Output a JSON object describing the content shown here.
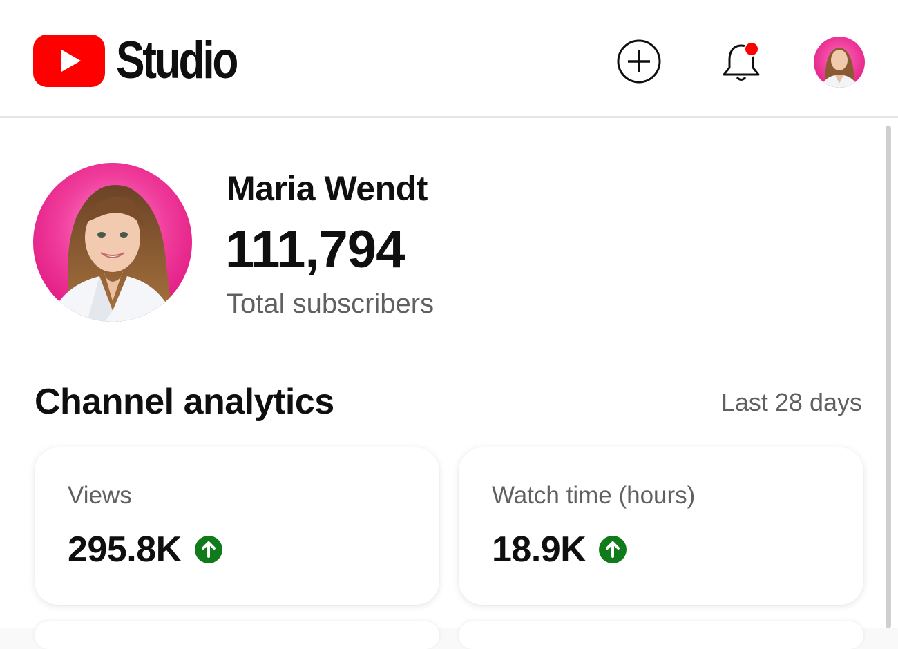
{
  "app": {
    "logo_icon": "youtube-play-logo",
    "logo_text": "Studio",
    "brand_color": "#ff0000"
  },
  "header": {
    "create_icon": "plus-circle-icon",
    "notifications_icon": "bell-icon",
    "notification_badge_color": "#ff0000",
    "account_icon": "account-avatar"
  },
  "channel": {
    "name": "Maria Wendt",
    "subscriber_count": "111,794",
    "subscriber_label": "Total subscribers",
    "avatar_background": "#e8228a"
  },
  "analytics": {
    "title": "Channel analytics",
    "period": "Last 28 days",
    "trend_color": "#0f7b1a",
    "cards": [
      {
        "label": "Views",
        "value": "295.8K",
        "trend": "up",
        "trend_icon": "arrow-up-circle-icon"
      },
      {
        "label": "Watch time (hours)",
        "value": "18.9K",
        "trend": "up",
        "trend_icon": "arrow-up-circle-icon"
      }
    ]
  }
}
